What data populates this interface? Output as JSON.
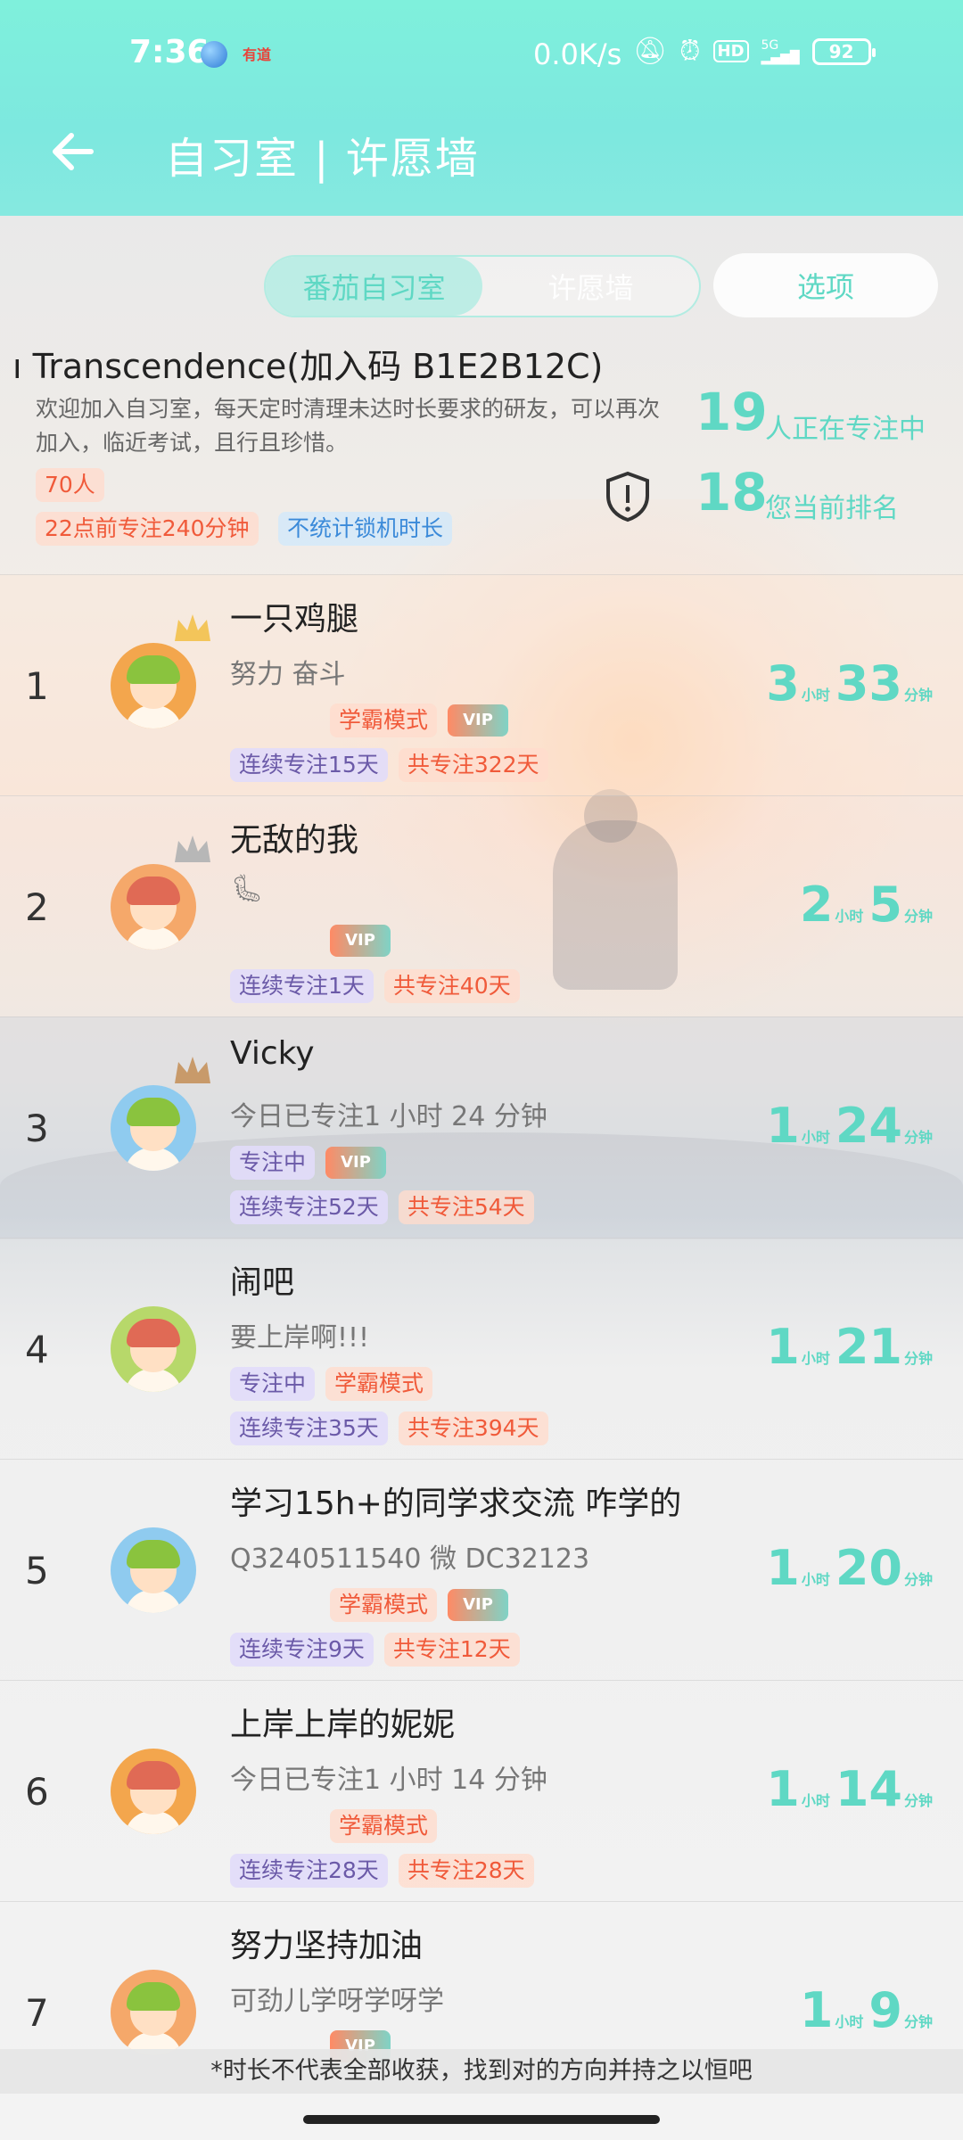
{
  "status_bar": {
    "time": "7:36",
    "app_label": "有道",
    "net_speed": "0.0K/s",
    "hd": "HD",
    "signal": "5G",
    "battery": "92"
  },
  "header": {
    "title": "自习室 | 许愿墙",
    "back_icon": "arrow-left-icon"
  },
  "tabs": [
    {
      "label": "番茄自习室",
      "active": true
    },
    {
      "label": "许愿墙",
      "active": false
    }
  ],
  "options_label": "选项",
  "room": {
    "name": "ı Transcendence(加入码 B1E2B12C)",
    "description": "欢迎加入自习室，每天定时清理未达时长要求的研友，可以再次加入，临近考试，且行且珍惜。",
    "member_count": "70人",
    "requirement": "22点前专注240分钟",
    "lock_rule": "不统计锁机时长",
    "focusing_count": "19",
    "focusing_label": "人正在专注中",
    "my_rank": "18",
    "my_rank_label": "您当前排名"
  },
  "members": [
    {
      "rank": "1",
      "name": "一只鸡腿",
      "motto": "努力 奋斗",
      "status": "",
      "mode": "学霸模式",
      "vip": "VIP",
      "streak": "连续专注15天",
      "total": "共专注322天",
      "hours": "3",
      "hours_unit": "小时",
      "minutes": "33",
      "minutes_unit": "分钟",
      "crown": "gold",
      "avatar_color": "#f3a64d"
    },
    {
      "rank": "2",
      "name": "无敌的我",
      "motto": "🐛",
      "status": "",
      "mode": "",
      "vip": "VIP",
      "streak": "连续专注1天",
      "total": "共专注40天",
      "hours": "2",
      "hours_unit": "小时",
      "minutes": "5",
      "minutes_unit": "分钟",
      "crown": "silver",
      "avatar_color": "#f5a86a"
    },
    {
      "rank": "3",
      "name": "Vicky",
      "motto": "今日已专注1 小时 24 分钟",
      "status": "专注中",
      "mode": "",
      "vip": "VIP",
      "streak": "连续专注52天",
      "total": "共专注54天",
      "hours": "1",
      "hours_unit": "小时",
      "minutes": "24",
      "minutes_unit": "分钟",
      "crown": "bronze",
      "avatar_color": "#8fcbef"
    },
    {
      "rank": "4",
      "name": "闹吧",
      "motto": "要上岸啊!!!",
      "status": "专注中",
      "mode": "学霸模式",
      "vip": "",
      "streak": "连续专注35天",
      "total": "共专注394天",
      "hours": "1",
      "hours_unit": "小时",
      "minutes": "21",
      "minutes_unit": "分钟",
      "crown": "",
      "avatar_color": "#b7d86a"
    },
    {
      "rank": "5",
      "name": "学习15h+的同学求交流 咋学的",
      "motto": "Q3240511540  微 DC32123",
      "status": "",
      "mode": "学霸模式",
      "vip": "VIP",
      "streak": "连续专注9天",
      "total": "共专注12天",
      "hours": "1",
      "hours_unit": "小时",
      "minutes": "20",
      "minutes_unit": "分钟",
      "crown": "",
      "avatar_color": "#8fcbef"
    },
    {
      "rank": "6",
      "name": "上岸上岸的妮妮",
      "motto": "今日已专注1 小时 14 分钟",
      "status": "",
      "mode": "学霸模式",
      "vip": "",
      "streak": "连续专注28天",
      "total": "共专注28天",
      "hours": "1",
      "hours_unit": "小时",
      "minutes": "14",
      "minutes_unit": "分钟",
      "crown": "",
      "avatar_color": "#f3a64d"
    },
    {
      "rank": "7",
      "name": "努力坚持加油",
      "motto": "可劲儿学呀学呀学",
      "status": "",
      "mode": "",
      "vip": "VIP",
      "streak": "",
      "total": "",
      "hours": "1",
      "hours_unit": "小时",
      "minutes": "9",
      "minutes_unit": "分钟",
      "crown": "",
      "avatar_color": "#f5a86a"
    }
  ],
  "footer_note": "*时长不代表全部收获，找到对的方向并持之以恒吧"
}
